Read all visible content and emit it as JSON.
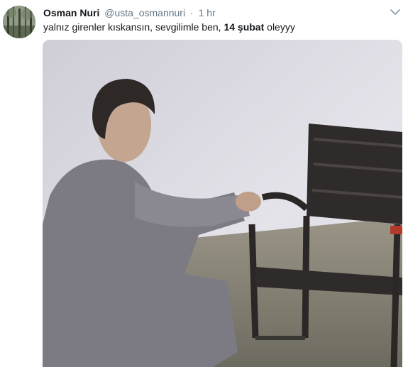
{
  "tweet": {
    "author_name": "Osman Nuri",
    "author_handle": "@usta_osmannuri",
    "separator": "·",
    "time": "1 hr",
    "text_parts": {
      "before": "yalnız girenler kıskansın, sevgilimle ben, ",
      "bold": "14 şubat",
      "after": " oleyyy"
    },
    "avatar_icon": "forest-avatar",
    "menu_icon": "chevron-down-icon",
    "media_description_icon": "video-frame"
  },
  "colors": {
    "name": "#14171a",
    "meta": "#657786",
    "text": "#14171a"
  }
}
